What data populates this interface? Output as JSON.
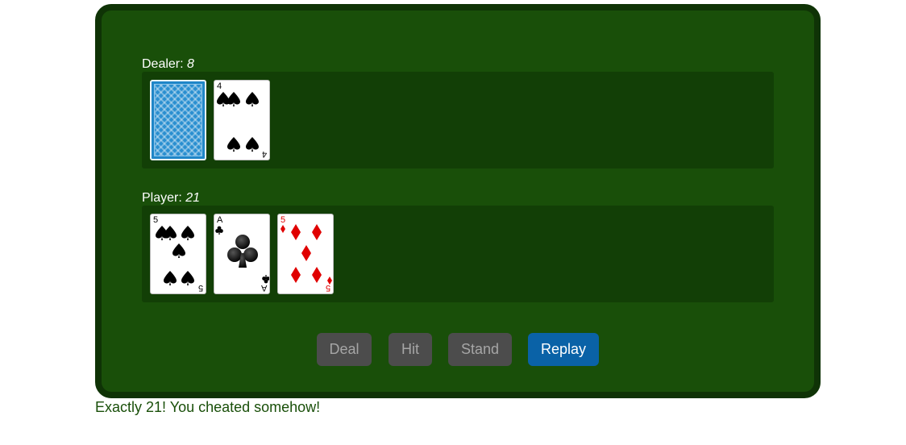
{
  "dealer": {
    "label": "Dealer: ",
    "score": "8",
    "cards": [
      {
        "face_down": true
      },
      {
        "rank": "4",
        "suit": "spades",
        "color": "#000000"
      }
    ]
  },
  "player": {
    "label": "Player: ",
    "score": "21",
    "cards": [
      {
        "rank": "5",
        "suit": "spades",
        "color": "#000000"
      },
      {
        "rank": "A",
        "suit": "clubs",
        "color": "#000000"
      },
      {
        "rank": "5",
        "suit": "diamonds",
        "color": "#e00000"
      }
    ]
  },
  "controls": {
    "deal_label": "Deal",
    "hit_label": "Hit",
    "stand_label": "Stand",
    "replay_label": "Replay"
  },
  "message": "Exactly 21! You cheated somehow!",
  "colors": {
    "table": "#194f09",
    "table_border": "#0f3306",
    "hand_area": "#123f06",
    "button_disabled": "#4c4c4c",
    "button_active": "#0a62a7",
    "message_text": "#194f09"
  }
}
